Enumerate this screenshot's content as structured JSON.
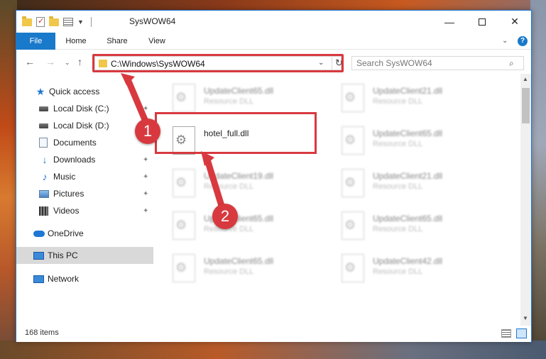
{
  "window": {
    "title": "SysWOW64",
    "controls": {
      "minimize": "—",
      "maximize": "",
      "close": "✕"
    }
  },
  "ribbon": {
    "tabs": [
      "File",
      "Home",
      "Share",
      "View"
    ],
    "expand_glyph": "⌄",
    "help_glyph": "?"
  },
  "nav": {
    "back": "←",
    "forward": "→",
    "recent": "⌄",
    "up": "↑",
    "address": "C:\\Windows\\SysWOW64",
    "address_dropdown": "⌄",
    "refresh": "↻",
    "search_placeholder": "Search SysWOW64",
    "search_glyph": "⌕"
  },
  "sidebar": {
    "items": [
      {
        "label": "Quick access",
        "icon": "star-icon",
        "pinned": false
      },
      {
        "label": "Local Disk (C:)",
        "icon": "disk-icon",
        "pinned": true
      },
      {
        "label": "Local Disk (D:)",
        "icon": "disk-icon",
        "pinned": false
      },
      {
        "label": "Documents",
        "icon": "documents-icon",
        "pinned": false
      },
      {
        "label": "Downloads",
        "icon": "downloads-icon",
        "pinned": true
      },
      {
        "label": "Music",
        "icon": "music-icon",
        "pinned": true
      },
      {
        "label": "Pictures",
        "icon": "pictures-icon",
        "pinned": true
      },
      {
        "label": "Videos",
        "icon": "videos-icon",
        "pinned": true
      },
      {
        "label": "OneDrive",
        "icon": "onedrive-icon",
        "pinned": false
      },
      {
        "label": "This PC",
        "icon": "pc-icon",
        "pinned": false,
        "selected": true
      },
      {
        "label": "Network",
        "icon": "network-icon",
        "pinned": false
      }
    ],
    "pin_glyph": "📌"
  },
  "files": [
    {
      "name": "UpdateClient65.dll",
      "type": "Resource DLL",
      "blurred": true
    },
    {
      "name": "UpdateClient21.dll",
      "type": "Resource DLL",
      "blurred": true
    },
    {
      "name": "hotel_full.dll",
      "type": "",
      "blurred": false
    },
    {
      "name": "UpdateClient65.dll",
      "type": "Resource DLL",
      "blurred": true
    },
    {
      "name": "UpdateClient19.dll",
      "type": "Resource DLL",
      "blurred": true
    },
    {
      "name": "UpdateClient21.dll",
      "type": "Resource DLL",
      "blurred": true
    },
    {
      "name": "UpdateClient65.dll",
      "type": "Resource DLL",
      "blurred": true
    },
    {
      "name": "UpdateClient65.dll",
      "type": "Resource DLL",
      "blurred": true
    },
    {
      "name": "UpdateClient65.dll",
      "type": "Resource DLL",
      "blurred": true
    },
    {
      "name": "UpdateClient42.dll",
      "type": "Resource DLL",
      "blurred": true
    }
  ],
  "status": {
    "item_count": "168 items"
  },
  "annotations": {
    "step1": "1",
    "step2": "2",
    "color": "#d8393f"
  },
  "colors": {
    "accent": "#1979ca",
    "highlight": "#d8393f"
  }
}
